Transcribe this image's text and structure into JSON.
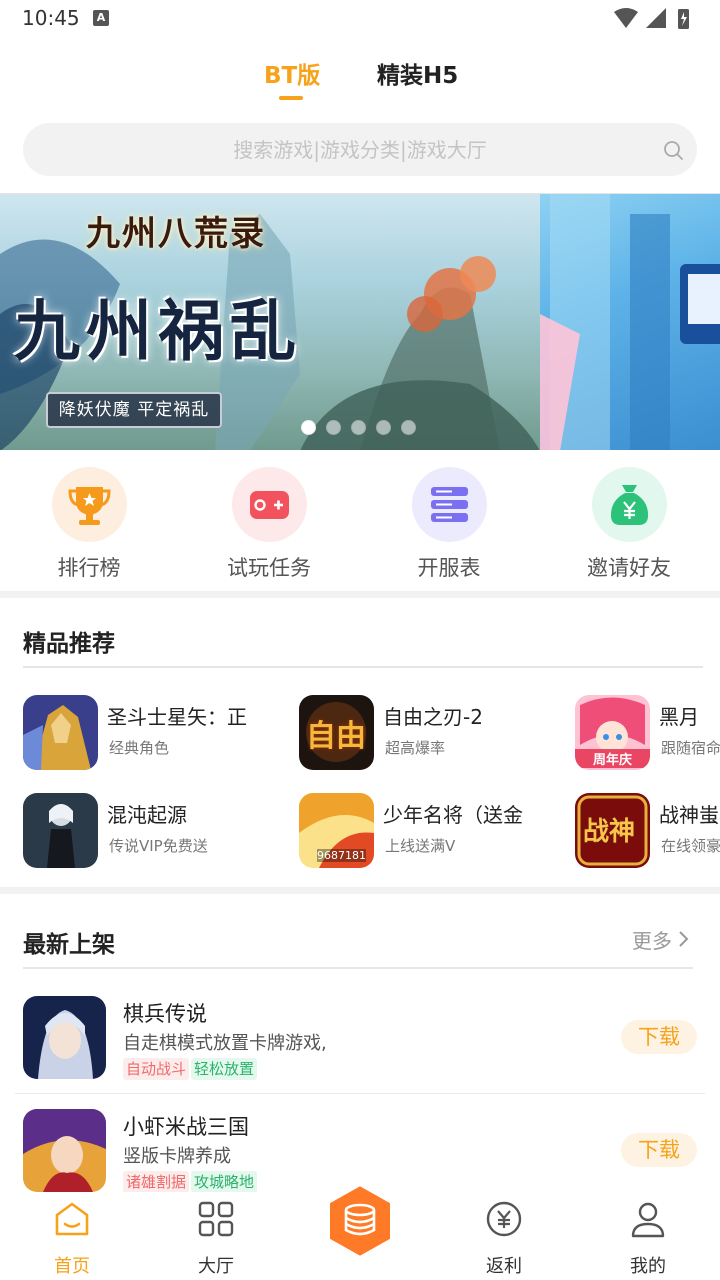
{
  "status_bar": {
    "time": "10:45",
    "notification_letter": "A"
  },
  "top_tabs": [
    {
      "label": "BT版",
      "active": true
    },
    {
      "label": "精装H5",
      "active": false
    }
  ],
  "search": {
    "placeholder": "搜索游戏|游戏分类|游戏大厅",
    "icon": "search-icon"
  },
  "banner": {
    "game_logo": "九州八荒录",
    "title": "九州祸乱",
    "subtitle": "降妖伏魔  平定祸乱",
    "dot_count": 5,
    "active_dot": 0
  },
  "quick_menu": [
    {
      "label": "排行榜",
      "icon": "trophy-icon",
      "bg": "#fdeee0",
      "color": "#f59a1b"
    },
    {
      "label": "试玩任务",
      "icon": "gamepad-icon",
      "bg": "#fde8ea",
      "color": "#f2525d"
    },
    {
      "label": "开服表",
      "icon": "server-list-icon",
      "bg": "#ecebfd",
      "color": "#7b6ff2"
    },
    {
      "label": "邀请好友",
      "icon": "money-bag-icon",
      "bg": "#e2f7ee",
      "color": "#2cc27a"
    }
  ],
  "recommended": {
    "title": "精品推荐",
    "items": [
      {
        "name": "圣斗士星矢：正",
        "desc": "经典角色"
      },
      {
        "name": "自由之刃-2",
        "desc": "超高爆率"
      },
      {
        "name": "黑月",
        "desc": "跟随宿命"
      },
      {
        "name": "混沌起源",
        "desc": "传说VIP免费送"
      },
      {
        "name": "少年名将（送金",
        "desc": "上线送满V"
      },
      {
        "name": "战神蚩",
        "desc": "在线领豪"
      }
    ],
    "thumb_texts": {
      "ziyou": "自由",
      "heiyue_badge": "周年庆",
      "shaonian": "9687181",
      "zhanshen": "战神"
    }
  },
  "newest": {
    "title": "最新上架",
    "more_label": "更多",
    "items": [
      {
        "name": "棋兵传说",
        "desc": "自走棋模式放置卡牌游戏,",
        "tags": [
          "自动战斗",
          "轻松放置"
        ],
        "button": "下载"
      },
      {
        "name": "小虾米战三国",
        "desc": "竖版卡牌养成",
        "tags": [
          "诸雄割据",
          "攻城略地"
        ],
        "button": "下载"
      }
    ]
  },
  "bottom_nav": [
    {
      "label": "首页",
      "icon": "home-icon",
      "active": true
    },
    {
      "label": "大厅",
      "icon": "grid-icon",
      "active": false
    },
    {
      "label": "",
      "icon": "coin-stack-icon",
      "active": false
    },
    {
      "label": "返利",
      "icon": "yen-circle-icon",
      "active": false
    },
    {
      "label": "我的",
      "icon": "user-icon",
      "active": false
    }
  ],
  "colors": {
    "accent": "#f6a21a",
    "tag_red": "#f06a6a",
    "tag_green": "#2ab46c"
  }
}
